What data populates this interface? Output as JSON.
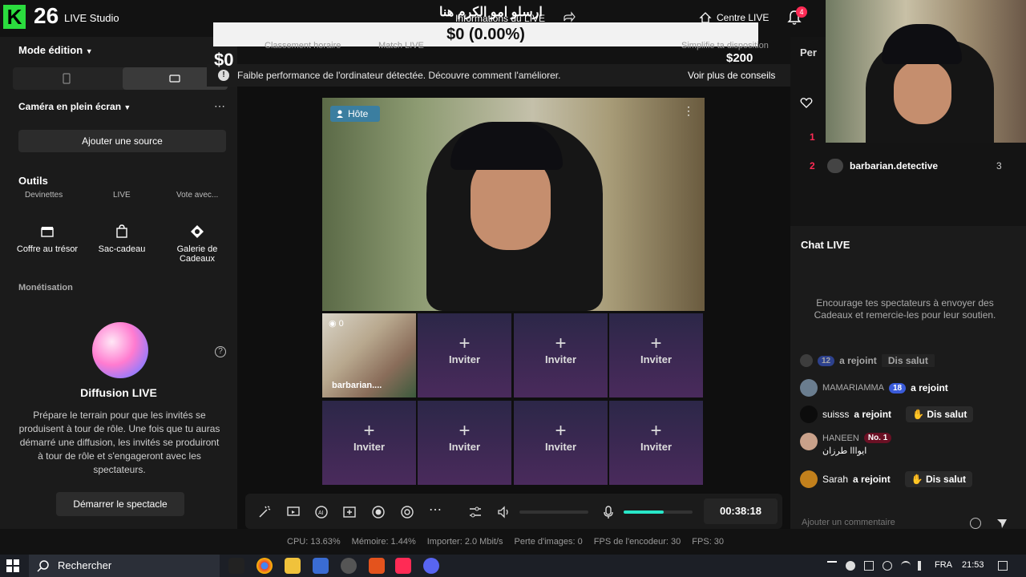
{
  "app": {
    "logo_letter": "K",
    "logo_number": "26",
    "title": "LIVE Studio",
    "live_info_label": "Informations du LIVE",
    "arabic_title": "ارسلو امو الكرم هنا",
    "center_live": "Centre LIVE",
    "notifications_count": "4"
  },
  "overlay": {
    "amount_bar": "$0 (0.00%)",
    "left_amount": "$0",
    "right_amount": "$200",
    "ghost_tabs": [
      "Classement horaire",
      "Match LIVE",
      "Simplifie ta disposition"
    ]
  },
  "left_panel": {
    "mode_label": "Mode édition",
    "camera_label": "Caméra en plein écran",
    "add_source": "Ajouter une source",
    "tools_title": "Outils",
    "cut_tools": [
      "Devinettes",
      "LIVE",
      "Vote avec..."
    ],
    "tools": [
      {
        "label": "Coffre au trésor",
        "icon": "treasure-chest-icon"
      },
      {
        "label": "Sac-cadeau",
        "icon": "gift-bag-icon"
      },
      {
        "label": "Galerie de Cadeaux",
        "icon": "gift-gallery-icon"
      }
    ],
    "monetisation_title": "Monétisation",
    "diffusion_title": "Diffusion LIVE",
    "diffusion_desc": "Prépare le terrain pour que les invités se produisent à tour de rôle. Une fois que tu auras démarré une diffusion, les invités se produiront à tour de rôle et s'engageront avec les spectateurs.",
    "start_show": "Démarrer le spectacle"
  },
  "notification": {
    "text": "Faible performance de l'ordinateur détectée. Découvre comment l'améliorer.",
    "link": "Voir plus de conseils"
  },
  "stage": {
    "host_badge": "Hôte",
    "guest_name": "barbarian....",
    "guest_count": "0",
    "invite_label": "Inviter"
  },
  "controls": {
    "timer": "00:38:18",
    "mic_level": 0.58
  },
  "stats": {
    "cpu": "CPU: 13.63%",
    "memory": "Mémoire: 1.44%",
    "import": "Importer: 2.0 Mbit/s",
    "frame_loss": "Perte d'images: 0",
    "encoder_fps": "FPS de l'encodeur: 30",
    "fps": "FPS: 30"
  },
  "right_panel": {
    "per_label": "Per",
    "rank1": "1",
    "rank2_num": "2",
    "rank2_name": "barbarian.detective",
    "rank2_score": "3",
    "chat_title": "Chat LIVE",
    "chat_empty": "Encourage tes spectateurs à envoyer des Cadeaux et remercie-les pour leur soutien.",
    "chat": [
      {
        "user": "MAMARIAMMA",
        "level": "18",
        "text": "a rejoint",
        "hi": ""
      },
      {
        "user": "suisss",
        "level": "",
        "text": "a rejoint",
        "hi": "Dis salut"
      },
      {
        "user": "HANEEN",
        "level": "No. 1",
        "text": "ايوااا طرزان",
        "hi": ""
      },
      {
        "user": "Sarah",
        "level": "",
        "text": "a rejoint",
        "hi": "Dis salut"
      }
    ],
    "top_partial": {
      "level": "12",
      "text": "a rejoint",
      "hi": "Dis salut"
    },
    "comment_placeholder": "Ajouter un commentaire"
  },
  "taskbar": {
    "search": "Rechercher",
    "lang": "FRA",
    "time": "21:53"
  },
  "colors": {
    "accent_teal": "#28e6c8",
    "tiktok_red": "#ff2b55",
    "logo_green": "#2bdc3e"
  }
}
